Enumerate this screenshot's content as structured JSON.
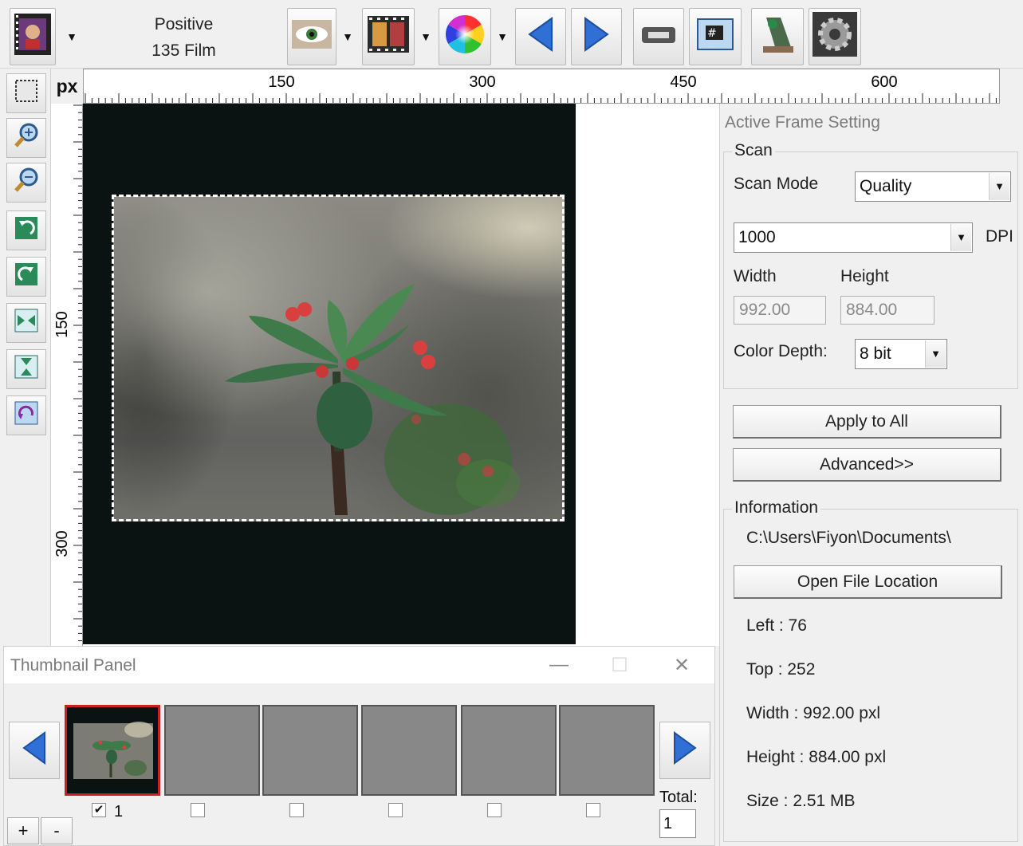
{
  "toolbar": {
    "film_line1": "Positive",
    "film_line2": "135 Film"
  },
  "ruler": {
    "unit": "px",
    "h_labels": [
      "150",
      "300",
      "450",
      "600"
    ],
    "v_labels": [
      "150",
      "300"
    ]
  },
  "frame_setting": {
    "title": "Active Frame Setting",
    "scan_group": "Scan",
    "scan_mode_label": "Scan Mode",
    "scan_mode_value": "Quality",
    "dpi_value": "1000",
    "dpi_unit": "DPI",
    "width_label": "Width",
    "height_label": "Height",
    "width_value": "992.00",
    "height_value": "884.00",
    "color_depth_label": "Color Depth:",
    "color_depth_value": "8 bit",
    "apply_all_label": "Apply to All",
    "advanced_label": "Advanced>>"
  },
  "information": {
    "group": "Information",
    "path": "C:\\Users\\Fiyon\\Documents\\",
    "open_location_label": "Open File Location",
    "left": "Left : 76",
    "top": "Top : 252",
    "width": "Width : 992.00 pxl",
    "height": "Height : 884.00 pxl",
    "size": "Size : 2.51 MB"
  },
  "thumbnail_panel": {
    "title": "Thumbnail Panel",
    "minimize": "—",
    "maximize": "☐",
    "close": "✕",
    "frame1_label": "1",
    "frame1_checked": "✔",
    "total_label": "Total:",
    "total_value": "1",
    "add_label": "+",
    "remove_label": "-"
  },
  "colors": {
    "film_background": "#0b1212",
    "empty_slot": "#888888",
    "active_slot_border": "#cc2020",
    "nav_arrow": "#2f6fd6"
  },
  "icons": [
    "film-type-icon",
    "eye-preview-icon",
    "filmstrip-icon",
    "color-wheel-icon",
    "previous-arrow-icon",
    "next-arrow-icon",
    "scanner-icon",
    "frame-number-icon",
    "stamp-icon",
    "settings-gear-icon",
    "select-rect-icon",
    "zoom-in-icon",
    "zoom-out-icon",
    "rotate-left-icon",
    "rotate-right-icon",
    "flip-horizontal-icon",
    "flip-vertical-icon",
    "reset-icon"
  ]
}
